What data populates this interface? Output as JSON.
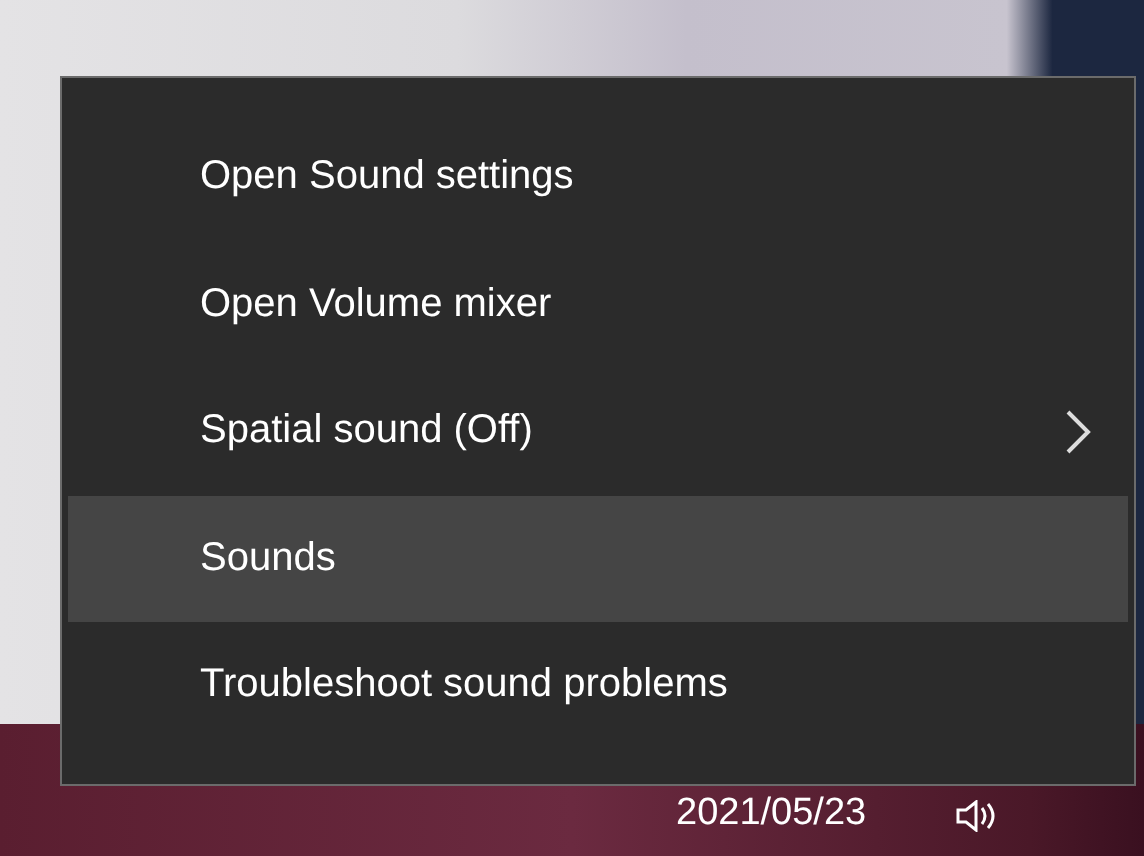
{
  "context_menu": {
    "items": [
      {
        "label": "Open Sound settings",
        "kind": "item",
        "selected": false
      },
      {
        "label": "Open Volume mixer",
        "kind": "item",
        "selected": false
      },
      {
        "label": "Spatial sound (Off)",
        "kind": "submenu",
        "selected": false
      },
      {
        "label": "Sounds",
        "kind": "item",
        "selected": true
      },
      {
        "label": "Troubleshoot sound problems",
        "kind": "item",
        "selected": false
      }
    ]
  },
  "taskbar": {
    "date": "2021/05/23"
  }
}
